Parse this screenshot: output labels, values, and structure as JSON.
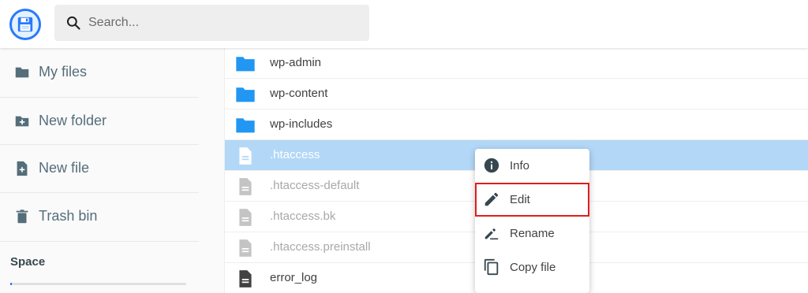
{
  "header": {
    "logo_icon": "floppy-disk-icon",
    "search": {
      "placeholder": "Search...",
      "value": "",
      "icon": "search-icon"
    }
  },
  "sidebar": {
    "items": [
      {
        "label": "My files",
        "icon": "folder-icon"
      },
      {
        "label": "New folder",
        "icon": "create-new-folder-icon"
      },
      {
        "label": "New file",
        "icon": "note-add-icon"
      },
      {
        "label": "Trash bin",
        "icon": "trash-icon"
      }
    ],
    "space": {
      "label": "Space",
      "used_fraction": 0.01
    }
  },
  "files": [
    {
      "name": "wp-admin",
      "type": "folder",
      "state": "normal"
    },
    {
      "name": "wp-content",
      "type": "folder",
      "state": "normal"
    },
    {
      "name": "wp-includes",
      "type": "folder",
      "state": "normal"
    },
    {
      "name": ".htaccess",
      "type": "file",
      "state": "selected"
    },
    {
      "name": ".htaccess-default",
      "type": "file",
      "state": "dim"
    },
    {
      "name": ".htaccess.bk",
      "type": "file",
      "state": "dim"
    },
    {
      "name": ".htaccess.preinstall",
      "type": "file",
      "state": "dim"
    },
    {
      "name": "error_log",
      "type": "file",
      "state": "normal"
    }
  ],
  "context_menu": {
    "items": [
      {
        "label": "Info",
        "icon": "info-icon"
      },
      {
        "label": "Edit",
        "icon": "pencil-icon",
        "highlighted": true
      },
      {
        "label": "Rename",
        "icon": "rename-icon"
      },
      {
        "label": "Copy file",
        "icon": "copy-icon"
      }
    ]
  },
  "colors": {
    "accent": "#2979ff",
    "folder": "#2196f3",
    "selection": "#b3d7f7",
    "highlight_border": "#e31c1c",
    "sidebar_text": "#546e7a"
  }
}
